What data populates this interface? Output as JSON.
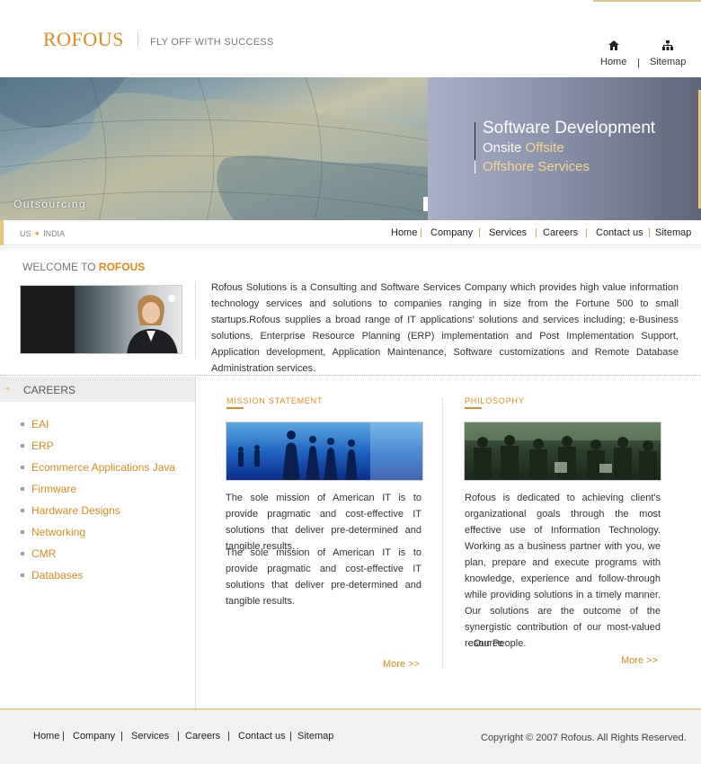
{
  "header": {
    "logo": "ROFOUS",
    "tagline": "FLY OFF WITH SUCCESS",
    "top_links": [
      {
        "label": "Home",
        "icon": "home-icon"
      },
      {
        "label": "Sitemap",
        "icon": "sitemap-icon"
      }
    ],
    "separator": "|"
  },
  "banner": {
    "map_caption": "Outsourcing",
    "line1": "Software Development",
    "line2_a": "Onsite",
    "line2_b": "Offsite",
    "line3": "Offshore Services"
  },
  "location": {
    "a": "US",
    "b": "INDIA"
  },
  "main_nav": [
    "Home",
    "Company",
    "Services",
    "Careers",
    "Contact us",
    "Sitemap"
  ],
  "welcome": {
    "prefix": "WELCOME TO",
    "brand": "ROFOUS",
    "intro": "Rofous Solutions is a Consulting and Software Services Company which provides high value information technology services and solutions to companies ranging in size from the Fortune 500 to small startups.Rofous supplies a broad range of IT applications' solutions and services including; e-Business solutions, Enterprise Resource Planning (ERP) implementation and Post Implementation Support, Application development, Application Maintenance, Software customizations and Remote Database Administration services."
  },
  "careers": {
    "title": "CAREERS",
    "items": [
      "EAI",
      "ERP",
      "Ecommerce Applications Java",
      "Firmware",
      "Hardware Designs",
      "Networking",
      "CMR",
      "Databases"
    ]
  },
  "mission": {
    "title": "MISSION STATEMENT",
    "para1": "The sole mission of American IT is to provide pragmatic and cost-effective IT solutions that deliver pre-determined and tangible results.",
    "para2": "The sole mission of American IT is to provide pragmatic and cost-effective IT solutions that deliver pre-determined and tangible results.",
    "more": "More >>"
  },
  "philosophy": {
    "title": "PHILOSOPHY",
    "text": "Rofous is dedicated to achieving client's organizational goals through the most effective use of Information Technology. Working as a business partner with you, we plan, prepare and execute programs with knowledge, experience and follow-through while providing solutions in a timely manner. Our solutions are the outcome of the synergistic contribution of our most-valued resource",
    "signoff": "- Our People.",
    "more": "More >>"
  },
  "footer": {
    "nav": [
      "Home",
      "Company",
      "Services",
      "Careers",
      "Contact us",
      "Sitemap"
    ],
    "copyright": "Copyright © 2007 Rofous. All Rights Reserved."
  },
  "colors": {
    "accent": "#e88a1a",
    "banner_gold": "#f7d78c",
    "footer_bg": "#f1f1f1"
  }
}
